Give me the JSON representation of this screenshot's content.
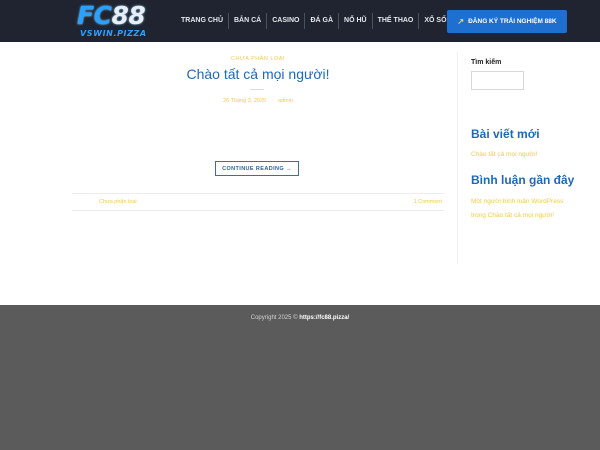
{
  "header": {
    "logo_main": "FC",
    "logo_num": "88",
    "logo_sub": "VSWIN.PIZZA",
    "nav": [
      "Trang chủ",
      "Bắn cá",
      "Casino",
      "Đá gà",
      "Nổ hũ",
      "Thể thao",
      "Xổ số"
    ],
    "cta_label": "Đăng ký trải nghiệm 88K",
    "cta_icon": "rocket-icon"
  },
  "post": {
    "category": "Chưa phân loại",
    "title": "Chào tất cả mọi người!",
    "date": "26 Tháng 3, 2025",
    "author": "admin",
    "continue_label": "Continue reading →",
    "footer_left": "Chưa phân loại",
    "footer_right": "1 Comment"
  },
  "sidebar": {
    "search_label": "Tìm kiếm",
    "search_value": "",
    "recent_title": "Bài viết mới",
    "recent_link": "Chào tất cả mọi người!",
    "comments_title": "Bình luận gần đây",
    "comment_author": "Một người bình luận WordPress",
    "comment_sep": "trong",
    "comment_post": "Chào tất cả mọi người!"
  },
  "footer": {
    "copyright_prefix": "Copyright 2025 ©",
    "copyright_site": "https://fc88.pizza/"
  },
  "colors": {
    "header_bg": "#1f2430",
    "accent_blue": "#2069b8",
    "cta_blue": "#1e6fd0",
    "link_yellow": "#f2c94c",
    "footer_bg": "#5b5b5b"
  }
}
